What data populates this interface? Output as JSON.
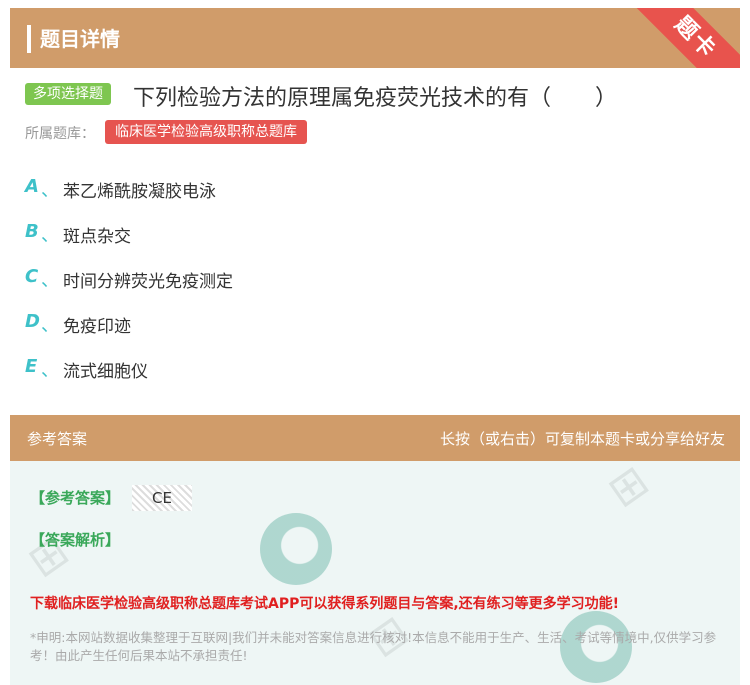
{
  "header": {
    "title": "题目详情",
    "ribbon": "题卡"
  },
  "question": {
    "type_tag": "多项选择题",
    "text": "下列检验方法的原理属免疫荧光技术的有（　　）",
    "bank_label": "所属题库：",
    "bank_name": "临床医学检验高级职称总题库"
  },
  "options": [
    {
      "letter": "A",
      "sep": "、",
      "text": "苯乙烯酰胺凝胶电泳"
    },
    {
      "letter": "B",
      "sep": "、",
      "text": "斑点杂交"
    },
    {
      "letter": "C",
      "sep": "、",
      "text": "时间分辨荧光免疫测定"
    },
    {
      "letter": "D",
      "sep": "、",
      "text": "免疫印迹"
    },
    {
      "letter": "E",
      "sep": "、",
      "text": "流式细胞仪"
    }
  ],
  "answer_header": {
    "left": "参考答案",
    "right": "长按（或右击）可复制本题卡或分享给好友"
  },
  "answer": {
    "answer_label": "【参考答案】",
    "answer_value": "CE",
    "analysis_label": "【答案解析】",
    "promo": "下载临床医学检验高级职称总题库考试APP可以获得系列题目与答案,还有练习等更多学习功能!",
    "disclaimer": "*申明:本网站数据收集整理于互联网|我们并未能对答案信息进行核对!本信息不能用于生产、生活、考试等情境中,仅供学习参考！由此产生任何后果本站不承担责任!"
  },
  "colors": {
    "header_bg": "#d09c6a",
    "ribbon": "#e8534d",
    "type_tag": "#7ec650",
    "bank_tag": "#e65450",
    "option_letter": "#3ec1c9",
    "answer_green": "#3aa85a",
    "promo_red": "#e02020"
  }
}
